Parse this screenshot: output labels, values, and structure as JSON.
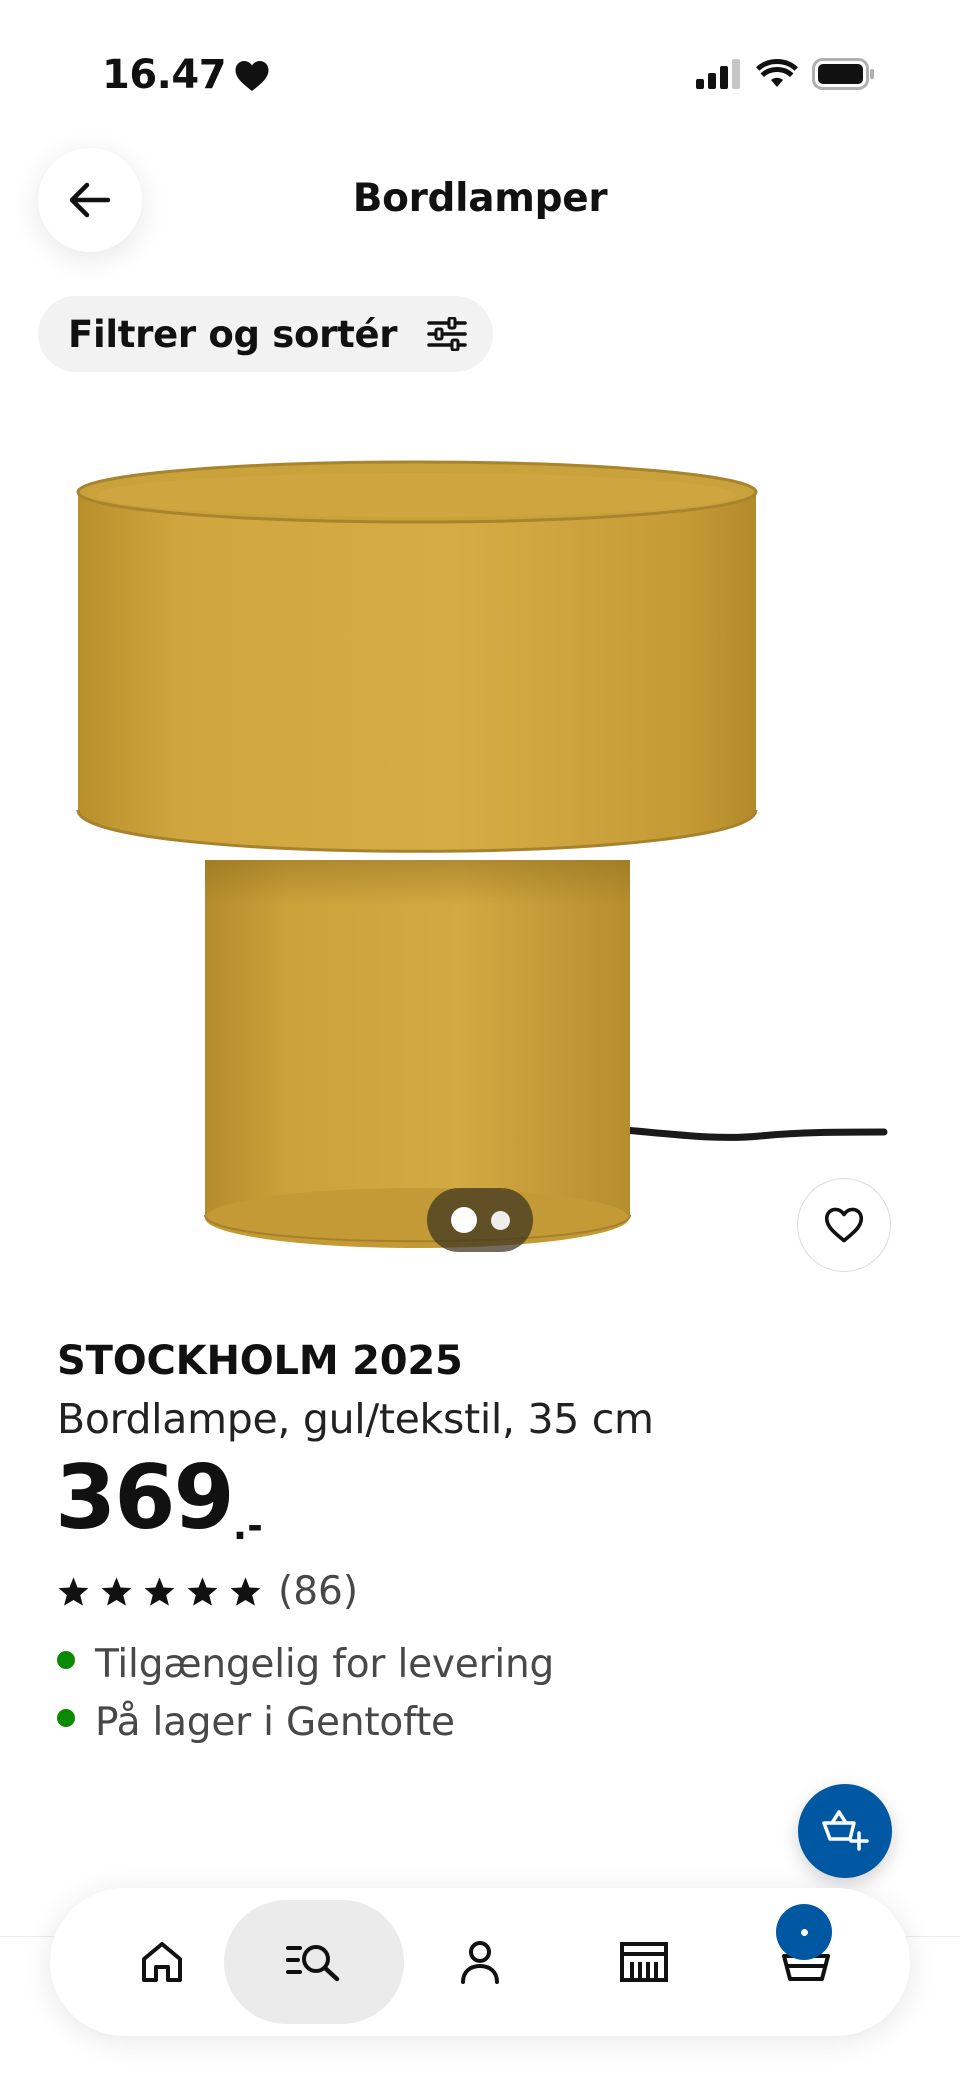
{
  "status_bar": {
    "time": "16.47",
    "icons": [
      "heart-icon",
      "signal-icon",
      "wifi-icon",
      "battery-icon"
    ]
  },
  "header": {
    "title": "Bordlamper",
    "back_icon": "arrow-left-icon"
  },
  "filter": {
    "label": "Filtrer og sortér",
    "icon": "sliders-icon"
  },
  "product": {
    "name": "STOCKHOLM 2025",
    "description": "Bordlampe, gul/tekstil, 35 cm",
    "price": "369",
    "price_suffix": ".-",
    "rating_stars": 5,
    "rating_count": "(86)",
    "image_count": 2,
    "active_image": 1,
    "stock": [
      {
        "text": "Tilgængelig for levering",
        "status_color": "#0a8a00"
      },
      {
        "text": "På lager i Gentofte",
        "status_color": "#0a8a00"
      }
    ]
  },
  "tabbar": {
    "items": [
      {
        "icon": "home-icon",
        "active": false
      },
      {
        "icon": "search-list-icon",
        "active": true
      },
      {
        "icon": "profile-icon",
        "active": false
      },
      {
        "icon": "store-icon",
        "active": false
      },
      {
        "icon": "cart-icon",
        "active": false
      }
    ]
  },
  "colors": {
    "brand_blue": "#0058a3",
    "stock_green": "#0a8a00",
    "lamp_yellow": "#c9a23a"
  }
}
